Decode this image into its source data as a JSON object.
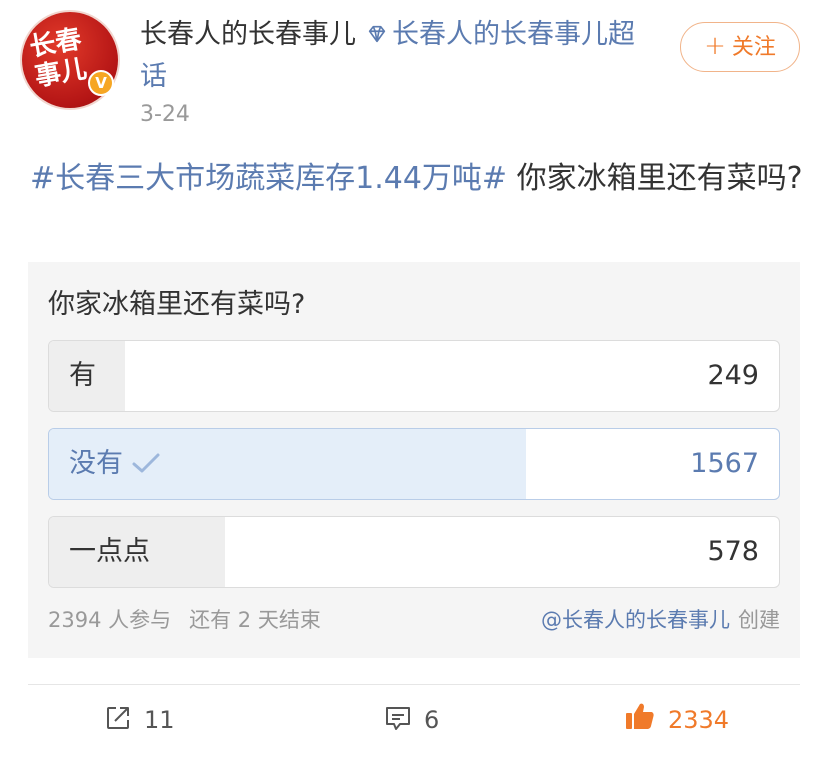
{
  "author": {
    "avatar_text_line1": "长春",
    "avatar_text_line2": "事儿",
    "verified_badge": "V",
    "name": "长春人的长春事儿",
    "supertopic": "长春人的长春事儿超话",
    "supertopic_icon": "diamond-icon",
    "time": "3-24"
  },
  "follow": {
    "plus": "+",
    "label": "关注"
  },
  "post": {
    "hashtag": "#长春三大市场蔬菜库存1.44万吨#",
    "text": " 你家冰箱里还有菜吗?"
  },
  "poll": {
    "title": "你家冰箱里还有菜吗?",
    "options": [
      {
        "label": "有",
        "count": "249",
        "share": 0.104,
        "selected": false
      },
      {
        "label": "没有",
        "count": "1567",
        "share": 0.654,
        "selected": true
      },
      {
        "label": "一点点",
        "count": "578",
        "share": 0.241,
        "selected": false
      }
    ],
    "participants": "2394 人参与",
    "remaining": "还有 2 天结束",
    "creator": "@长春人的长春事儿",
    "creator_suffix": "创建"
  },
  "actions": {
    "repost": "11",
    "comment": "6",
    "like": "2334"
  },
  "colors": {
    "link": "#5b7bb0",
    "accent": "#f07a2a",
    "selected_fill": "#e4eef9"
  }
}
